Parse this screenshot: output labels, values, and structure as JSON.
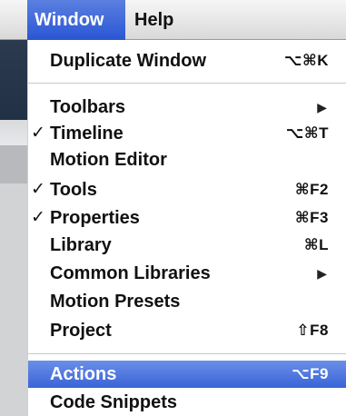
{
  "menubar": {
    "window_label": "Window",
    "help_label": "Help"
  },
  "menu": {
    "check_glyph": "✓",
    "submenu_glyph": "▶",
    "items": [
      {
        "label": "Duplicate Window",
        "shortcut": "⌥⌘K",
        "checked": false,
        "submenu": false
      },
      {
        "label": "Toolbars",
        "shortcut": "",
        "checked": false,
        "submenu": true
      },
      {
        "label": "Timeline",
        "shortcut": "⌥⌘T",
        "checked": true,
        "submenu": false
      },
      {
        "label": "Motion Editor",
        "shortcut": "",
        "checked": false,
        "submenu": false
      },
      {
        "label": "Tools",
        "shortcut": "⌘F2",
        "checked": true,
        "submenu": false
      },
      {
        "label": "Properties",
        "shortcut": "⌘F3",
        "checked": true,
        "submenu": false
      },
      {
        "label": "Library",
        "shortcut": "⌘L",
        "checked": false,
        "submenu": false
      },
      {
        "label": "Common Libraries",
        "shortcut": "",
        "checked": false,
        "submenu": true
      },
      {
        "label": "Motion Presets",
        "shortcut": "",
        "checked": false,
        "submenu": false
      },
      {
        "label": "Project",
        "shortcut": "⇧F8",
        "checked": false,
        "submenu": false
      },
      {
        "label": "Actions",
        "shortcut": "⌥F9",
        "checked": false,
        "submenu": false,
        "highlighted": true
      },
      {
        "label": "Code Snippets",
        "shortcut": "",
        "checked": false,
        "submenu": false
      }
    ]
  },
  "colors": {
    "menu_highlight": "#3a64d8",
    "menubar_active": "#2a56d4",
    "text": "#111111"
  }
}
